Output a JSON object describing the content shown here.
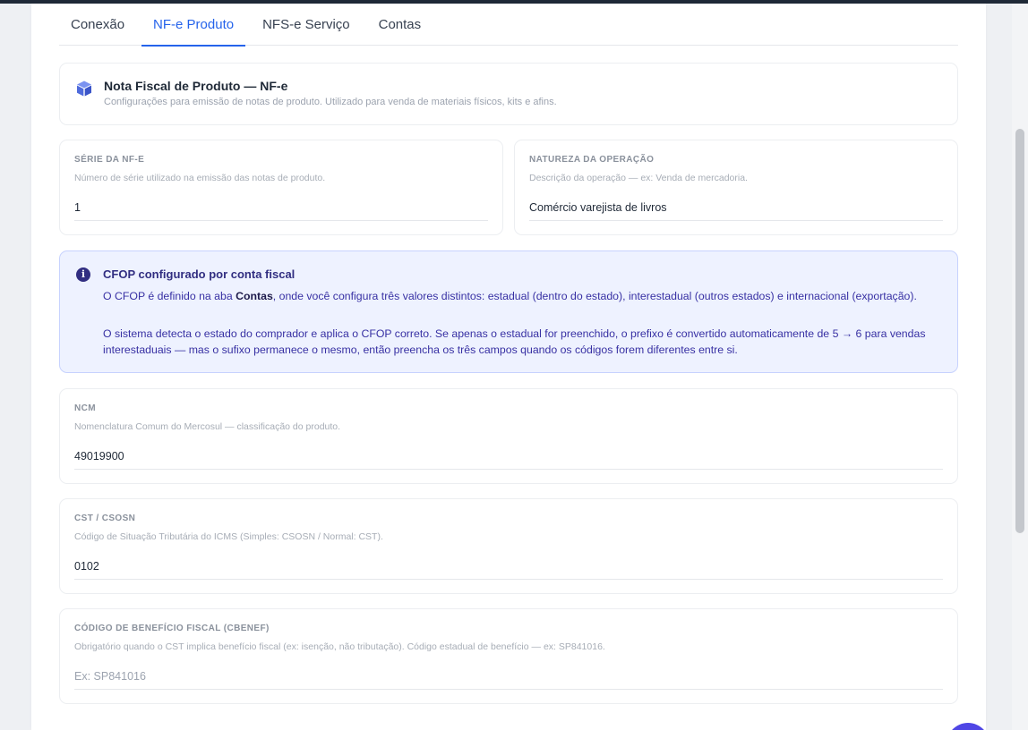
{
  "tabs": [
    {
      "label": "Conexão"
    },
    {
      "label": "NF-e Produto"
    },
    {
      "label": "NFS-e Serviço"
    },
    {
      "label": "Contas"
    }
  ],
  "header": {
    "title": "Nota Fiscal de Produto — NF-e",
    "subtitle": "Configurações para emissão de notas de produto. Utilizado para venda de materiais físicos, kits e afins."
  },
  "fields": {
    "serie": {
      "label": "Série da NF-e",
      "help": "Número de série utilizado na emissão das notas de produto.",
      "value": "1"
    },
    "natureza": {
      "label": "Natureza da operação",
      "help": "Descrição da operação — ex: Venda de mercadoria.",
      "value": "Comércio varejista de livros"
    },
    "ncm": {
      "label": "NCM",
      "help": "Nomenclatura Comum do Mercosul — classificação do produto.",
      "value": "49019900"
    },
    "cst": {
      "label": "CST / CSOSN",
      "help": "Código de Situação Tributária do ICMS (Simples: CSOSN / Normal: CST).",
      "value": "0102"
    },
    "cbenef": {
      "label": "Código de benefício fiscal (cBenef)",
      "help": "Obrigatório quando o CST implica benefício fiscal (ex: isenção, não tributação). Código estadual de benefício — ex: SP841016.",
      "value": "",
      "placeholder": "Ex: SP841016"
    }
  },
  "info": {
    "title": "CFOP configurado por conta fiscal",
    "p1_before": "O CFOP é definido na aba ",
    "p1_bold": "Contas",
    "p1_after": ", onde você configura três valores distintos: estadual (dentro do estado), interestadual (outros estados) e internacional (exportação).",
    "p2": "O sistema detecta o estado do comprador e aplica o CFOP correto. Se apenas o estadual for preenchido, o prefixo é convertido automaticamente de 5 → 6 para vendas interestaduais — mas o sufixo permanece o mesmo, então preencha os três campos quando os códigos forem diferentes entre si."
  },
  "colors": {
    "accent": "#2563eb",
    "info_bg": "#eef2ff",
    "info_text": "#3730a3",
    "icon": "#4f6bdc"
  },
  "icons": {
    "header": "box-icon",
    "info": "info-icon"
  }
}
